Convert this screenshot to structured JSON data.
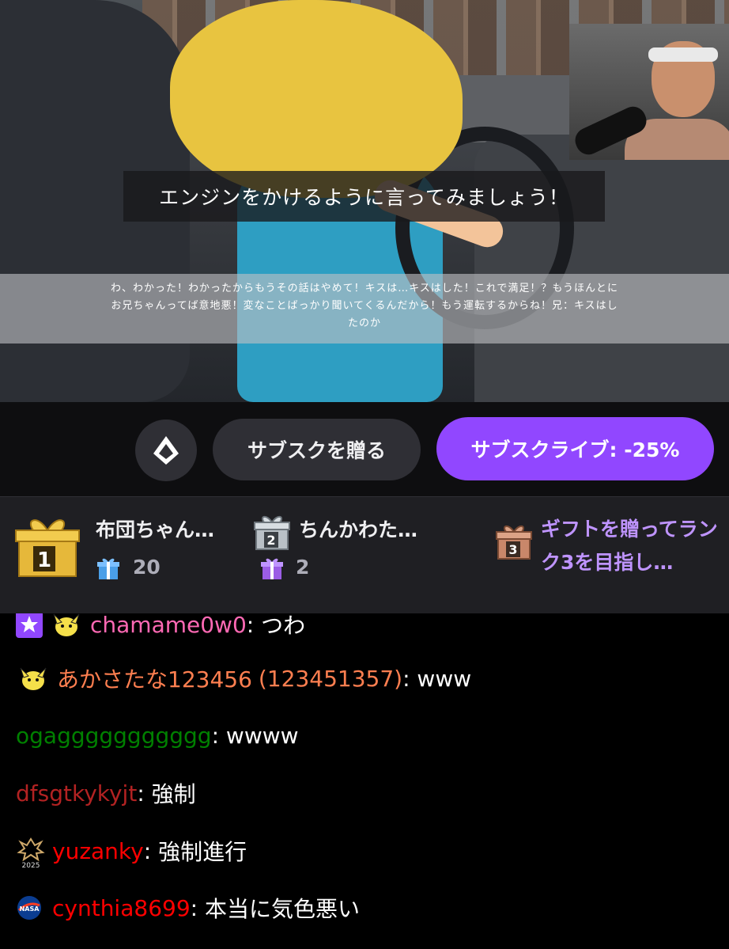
{
  "video": {
    "instruction": "エンジンをかけるように言ってみましょう！",
    "subtitle_lines": [
      "わ、わかった！わかったからもうその話はやめて！キスは…キスはした！これで満足！？もうほんとに",
      "お兄ちゃんってば意地悪！変なことばっかり聞いてくるんだから！もう運転するからね！兄：キスはし",
      "たのか"
    ]
  },
  "actions": {
    "prime_icon": "prime-crown-icon",
    "gift_sub_label": "サブスクを贈る",
    "subscribe_label": "サブスクライブ: -25%"
  },
  "leaderboard": {
    "ranks": [
      {
        "rank": "1",
        "name": "布団ちゃん…",
        "count": "20"
      },
      {
        "rank": "2",
        "name": "ちんかわた…",
        "count": "2"
      },
      {
        "rank": "3",
        "cta": "ギフトを贈ってランク3を目指し…"
      }
    ],
    "colors": {
      "gold": "#e6b83a",
      "silver": "#b9c0c6",
      "bronze": "#c9876a",
      "accent": "#bf94ff"
    }
  },
  "chat": {
    "messages": [
      {
        "user": "chamame0w0",
        "text": "つわ",
        "color": "#ff69b4",
        "badges": [
          "prime-star-icon",
          "pichu-icon"
        ]
      },
      {
        "user": "あかさたな123456",
        "user_extra": "(123451357)",
        "text": "www",
        "color": "#ff7f50",
        "badges": [
          "pichu-icon"
        ]
      },
      {
        "user": "ogaggggggggggg",
        "text": "wwww",
        "color": "#008000",
        "badges": []
      },
      {
        "user": "dfsgtkykyjt",
        "text": "強制",
        "color": "#b22222",
        "badges": []
      },
      {
        "user": "yuzanky",
        "text": "強制進行",
        "color": "#ff0000",
        "badges": [
          "2025-badge-icon"
        ]
      },
      {
        "user": "cynthia8699",
        "text": "本当に気色悪い",
        "color": "#ff0000",
        "badges": [
          "nasa-icon"
        ]
      }
    ]
  }
}
